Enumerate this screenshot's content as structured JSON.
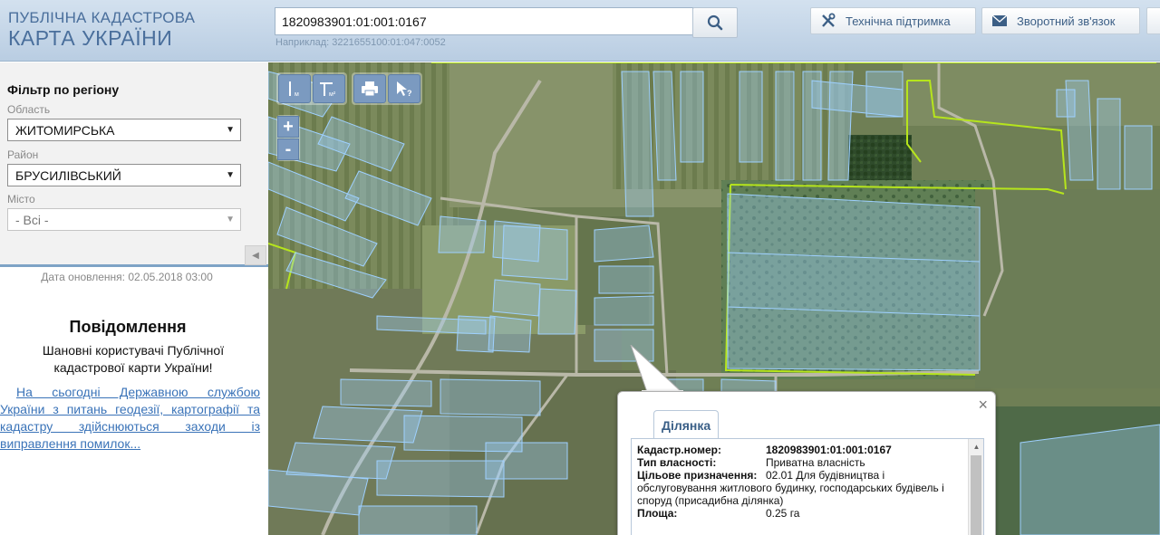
{
  "header": {
    "logo_line1": "ПУБЛІЧНА КАДАСТРОВА",
    "logo_line2": "КАРТА УКРАЇНИ",
    "search": {
      "value": "1820983901:01:001:0167",
      "hint": "Наприклад: 3221655100:01:047:0052"
    },
    "support_label": "Технічна підтримка",
    "feedback_label": "Зворотний зв'язок"
  },
  "sidebar": {
    "filter_title": "Фільтр по регіону",
    "region_label": "Область",
    "region_value": "ЖИТОМИРСЬКА",
    "district_label": "Район",
    "district_value": "БРУСИЛІВСЬКИЙ",
    "city_label": "Місто",
    "city_value": "- Всі -",
    "update_date": "Дата оновлення: 02.05.2018 03:00",
    "notice_title": "Повідомлення",
    "notice_text": "Шановні користувачі Публічної кадастрової карти України!",
    "notice_link": "На сьогодні Державною службою України з питань геодезії, картографії та кадастру здійснюються заходи із виправлення помилок..."
  },
  "popup": {
    "tab_label": "Ділянка",
    "rows": [
      {
        "key": "Кадастр.номер:",
        "value": "1820983901:01:001:0167"
      },
      {
        "key": "Тип власності:",
        "value": "Приватна власність"
      },
      {
        "key": "Цільове призначення:",
        "value": "02.01 Для будівництва і"
      },
      {
        "key": "",
        "value": "обслуговування житлового будинку, господарських будівель і споруд (присадибна ділянка)"
      },
      {
        "key": "Площа:",
        "value": "0.25 га"
      }
    ]
  },
  "colors": {
    "accent": "#4a6f9c",
    "parcel": "#9ed0ff",
    "boundary": "#b6e51c",
    "link": "#3a73b8"
  },
  "icons": [
    "search-icon",
    "wrench-icon",
    "mail-icon",
    "measure-line-icon",
    "measure-area-icon",
    "print-icon",
    "identify-icon",
    "close-icon",
    "chevron-left-icon"
  ]
}
